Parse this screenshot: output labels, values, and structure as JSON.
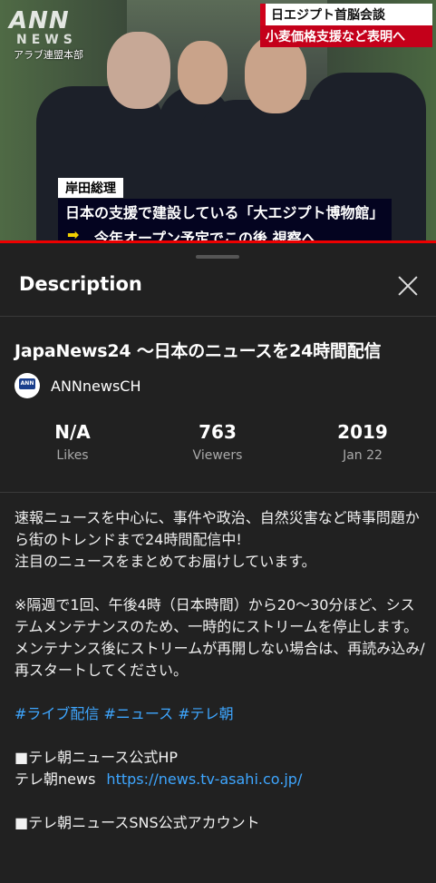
{
  "video": {
    "logo": "ANN",
    "logo_sub": "NEWS",
    "location": "アラブ連盟本部",
    "headline_line1": "日エジプト首脳会談",
    "headline_line2": "小麦価格支援など表明へ",
    "caption_name": "岸田総理",
    "caption_line1": "日本の支援で建設している「大エジプト博物館」",
    "caption_line2": "今年オープン予定でこの後 視察へ"
  },
  "sheet": {
    "title": "Description",
    "video_title": "JapaNews24 〜日本のニュースを24時間配信",
    "channel_name": "ANNnewsCH",
    "avatar_text": "ANN",
    "stats": [
      {
        "value": "N/A",
        "label": "Likes"
      },
      {
        "value": "763",
        "label": "Viewers"
      },
      {
        "value": "2019",
        "label": "Jan 22"
      }
    ],
    "desc_p1": "速報ニュースを中心に、事件や政治、自然災害など時事問題から街のトレンドまで24時間配信中!",
    "desc_p2": "注目のニュースをまとめてお届けしています。",
    "desc_p3": "※隔週で1回、午後4時（日本時間）から20〜30分ほど、システムメンテナンスのため、一時的にストリームを停止します。",
    "desc_p4": "メンテナンス後にストリームが再開しない場合は、再読み込み/再スタートしてください。",
    "hashtags": [
      "#ライブ配信",
      "#ニュース",
      "#テレ朝"
    ],
    "hp_heading": "■テレ朝ニュース公式HP",
    "hp_label": "テレ朝news",
    "hp_url": "https://news.tv-asahi.co.jp/",
    "sns_heading": "■テレ朝ニュースSNS公式アカウント"
  }
}
